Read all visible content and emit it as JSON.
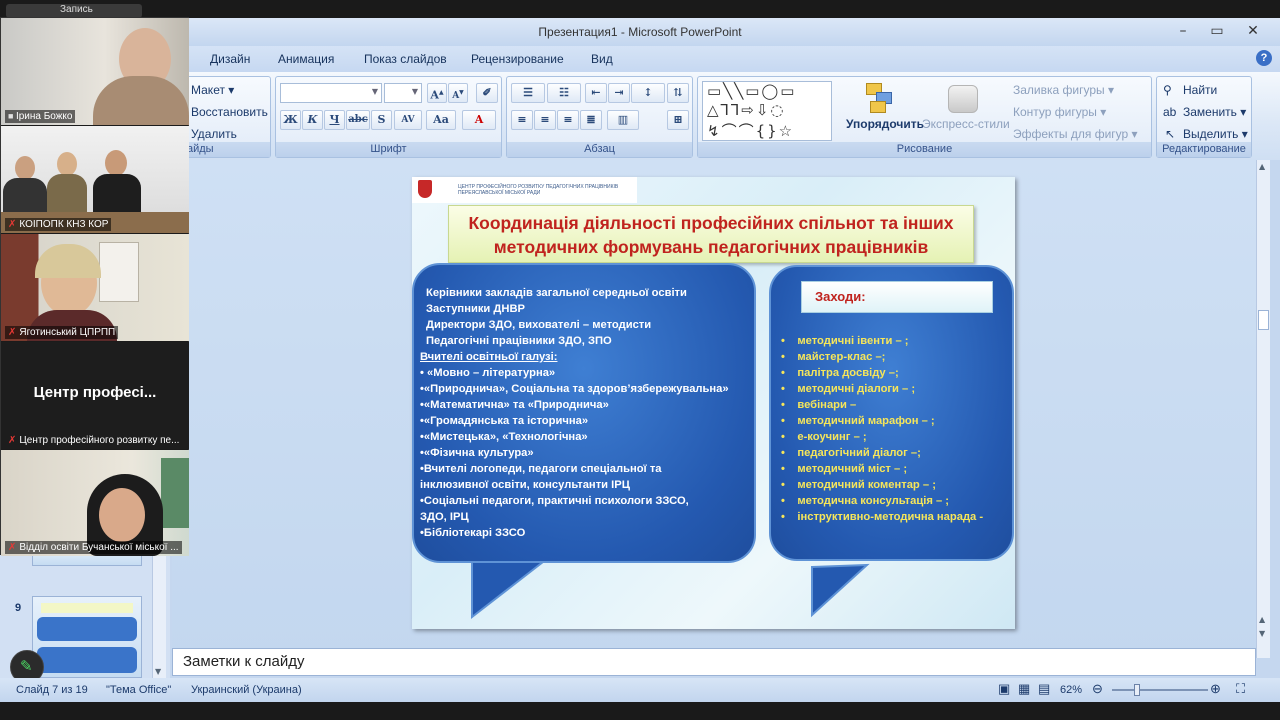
{
  "app": {
    "title": "Презентация1 - Microsoft PowerPoint",
    "ribbon_tabs": [
      "Дизайн",
      "Анимация",
      "Показ слайдов",
      "Рецензирование",
      "Вид"
    ],
    "help_glyph": "?"
  },
  "ribbon": {
    "slides_group": {
      "maket": "Макет ▾",
      "restore": "Восстановить",
      "delete": "Удалить",
      "label": "айды"
    },
    "font_group": {
      "label": "Шрифт",
      "buttons": [
        "Ж",
        "К",
        "Ч",
        "abc",
        "S",
        "AV",
        "Aa",
        "A"
      ]
    },
    "paragraph_group": {
      "label": "Абзац"
    },
    "drawing_group": {
      "label": "Рисование",
      "arrange": "Упорядочить",
      "quick_styles": "Экспресс-стили",
      "fill": "Заливка фигуры ▾",
      "outline": "Контур фигуры ▾",
      "effects": "Эффекты для фигур ▾"
    },
    "editing_group": {
      "label": "Редактирование",
      "find": "Найти",
      "replace": "Заменить ▾",
      "select": "Выделить ▾"
    }
  },
  "slides_panel": {
    "visible_slide_number": "9"
  },
  "video": {
    "top_strip": "Запись",
    "tiles": [
      {
        "name": "Ірина Божко",
        "muted": false
      },
      {
        "name": "КОІПОПК КНЗ КОР",
        "muted": true
      },
      {
        "name": "Яготинський ЦПРПП",
        "muted": true
      },
      {
        "name": "Центр професійного розвитку пе...",
        "muted": true,
        "big_text": "Центр професі..."
      },
      {
        "name": "Відділ освіти Бучанської міської ...",
        "muted": true
      }
    ]
  },
  "slide": {
    "header_text": "ЦЕНТР ПРОФЕСІЙНОГО РОЗВИТКУ ПЕДАГОГІЧНИХ ПРАЦІВНИКІВ ПЕРЕЯСЛАВСЬКОЇ МІСЬКОЇ РАДИ",
    "title_line1": "Координація діяльності професійних спільнот та інших",
    "title_line2": "методичних формувань педагогічних працівників",
    "left_lines": [
      "Керівники закладів загальної середньої освіти",
      "Заступники ДНВР",
      "Директори ЗДО, вихователі – методисти",
      "Педагогічні працівники ЗДО, ЗПО",
      "Вчителі освітньої галузі:",
      "• «Мовно – літературна»",
      "•«Природнича», Соціальна та здоров’язбережувальна»",
      "•«Математична» та «Природнича»",
      "•«Громадянська та історична»",
      "•«Мистецька», «Технологічна»",
      "•«Фізична культура»",
      "•Вчителі логопеди, педагоги спеціальної та",
      " інклюзивної освіти, консультанти ІРЦ",
      "•Соціальні педагоги, практичні психологи ЗЗСО,",
      " ЗДО, ІРЦ",
      "•Бібліотекарі ЗЗСО"
    ],
    "right_title": "Заходи:",
    "right_items": [
      "методичні івенти – ;",
      "майстер-клас –;",
      "палітра досвіду –;",
      "методичні діалоги – ;",
      "вебінари –",
      "методичний марафон – ;",
      "е-коучинг – ;",
      "педагогічний діалог –;",
      "методичний міст – ;",
      "методичний коментар – ;",
      "методична консультація – ;",
      "інструктивно-методична нарада -"
    ],
    "bullet_glyph": "•"
  },
  "notes": {
    "placeholder": "Заметки к слайду"
  },
  "status": {
    "slide": "Слайд 7 из 19",
    "theme": "\"Тема Office\"",
    "language": "Украинский (Украина)",
    "zoom": "62%"
  }
}
